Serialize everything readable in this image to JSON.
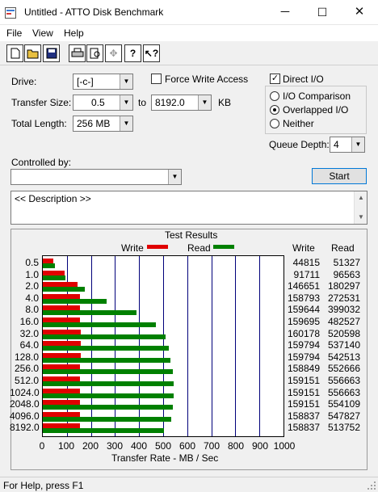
{
  "window": {
    "title": "Untitled - ATTO Disk Benchmark",
    "minimize": "─",
    "maximize": "☐",
    "close": "✕"
  },
  "menu": [
    "File",
    "View",
    "Help"
  ],
  "toolbar": [
    "new-icon",
    "open-icon",
    "save-icon",
    "print-icon",
    "print-preview-icon",
    "move-icon",
    "help-icon",
    "context-help-icon"
  ],
  "drive": {
    "label": "Drive:",
    "value": "[-c-]"
  },
  "transfer_size": {
    "label": "Transfer Size:",
    "from": "0.5",
    "to_label": "to",
    "to": "8192.0",
    "unit": "KB"
  },
  "total_length": {
    "label": "Total Length:",
    "value": "256 MB"
  },
  "force_write": {
    "label": "Force Write Access",
    "checked": false
  },
  "direct_io": {
    "label": "Direct I/O",
    "checked": true
  },
  "io_mode": {
    "options": [
      "I/O Comparison",
      "Overlapped I/O",
      "Neither"
    ],
    "selected": "Overlapped I/O"
  },
  "queue_depth": {
    "label": "Queue Depth:",
    "value": "4"
  },
  "controlled_by": {
    "label": "Controlled by:",
    "value": ""
  },
  "start_button": "Start",
  "description": "<< Description >>",
  "results": {
    "title": "Test Results",
    "legend_write": "Write",
    "legend_read": "Read",
    "col_write": "Write",
    "col_read": "Read",
    "xlabel": "Transfer Rate - MB / Sec",
    "xticks": [
      "0",
      "100",
      "200",
      "300",
      "400",
      "500",
      "600",
      "700",
      "800",
      "900",
      "1000"
    ]
  },
  "colors": {
    "write": "#e00000",
    "read": "#008000",
    "grid": "#00007a"
  },
  "chart_data": {
    "type": "bar",
    "categories": [
      "0.5",
      "1.0",
      "2.0",
      "4.0",
      "8.0",
      "16.0",
      "32.0",
      "64.0",
      "128.0",
      "256.0",
      "512.0",
      "1024.0",
      "2048.0",
      "4096.0",
      "8192.0"
    ],
    "xlabel": "Transfer Rate - MB / Sec",
    "xlim": [
      0,
      1000
    ],
    "series": [
      {
        "name": "Write",
        "values": [
          44815,
          91711,
          146651,
          158793,
          159644,
          159695,
          160178,
          159794,
          159794,
          158849,
          159151,
          159151,
          159151,
          158837,
          158837
        ]
      },
      {
        "name": "Read",
        "values": [
          51327,
          96563,
          180297,
          272531,
          399032,
          482527,
          520598,
          537140,
          542513,
          552666,
          556663,
          556663,
          554109,
          547827,
          513752
        ]
      }
    ]
  },
  "status": "For Help, press F1"
}
